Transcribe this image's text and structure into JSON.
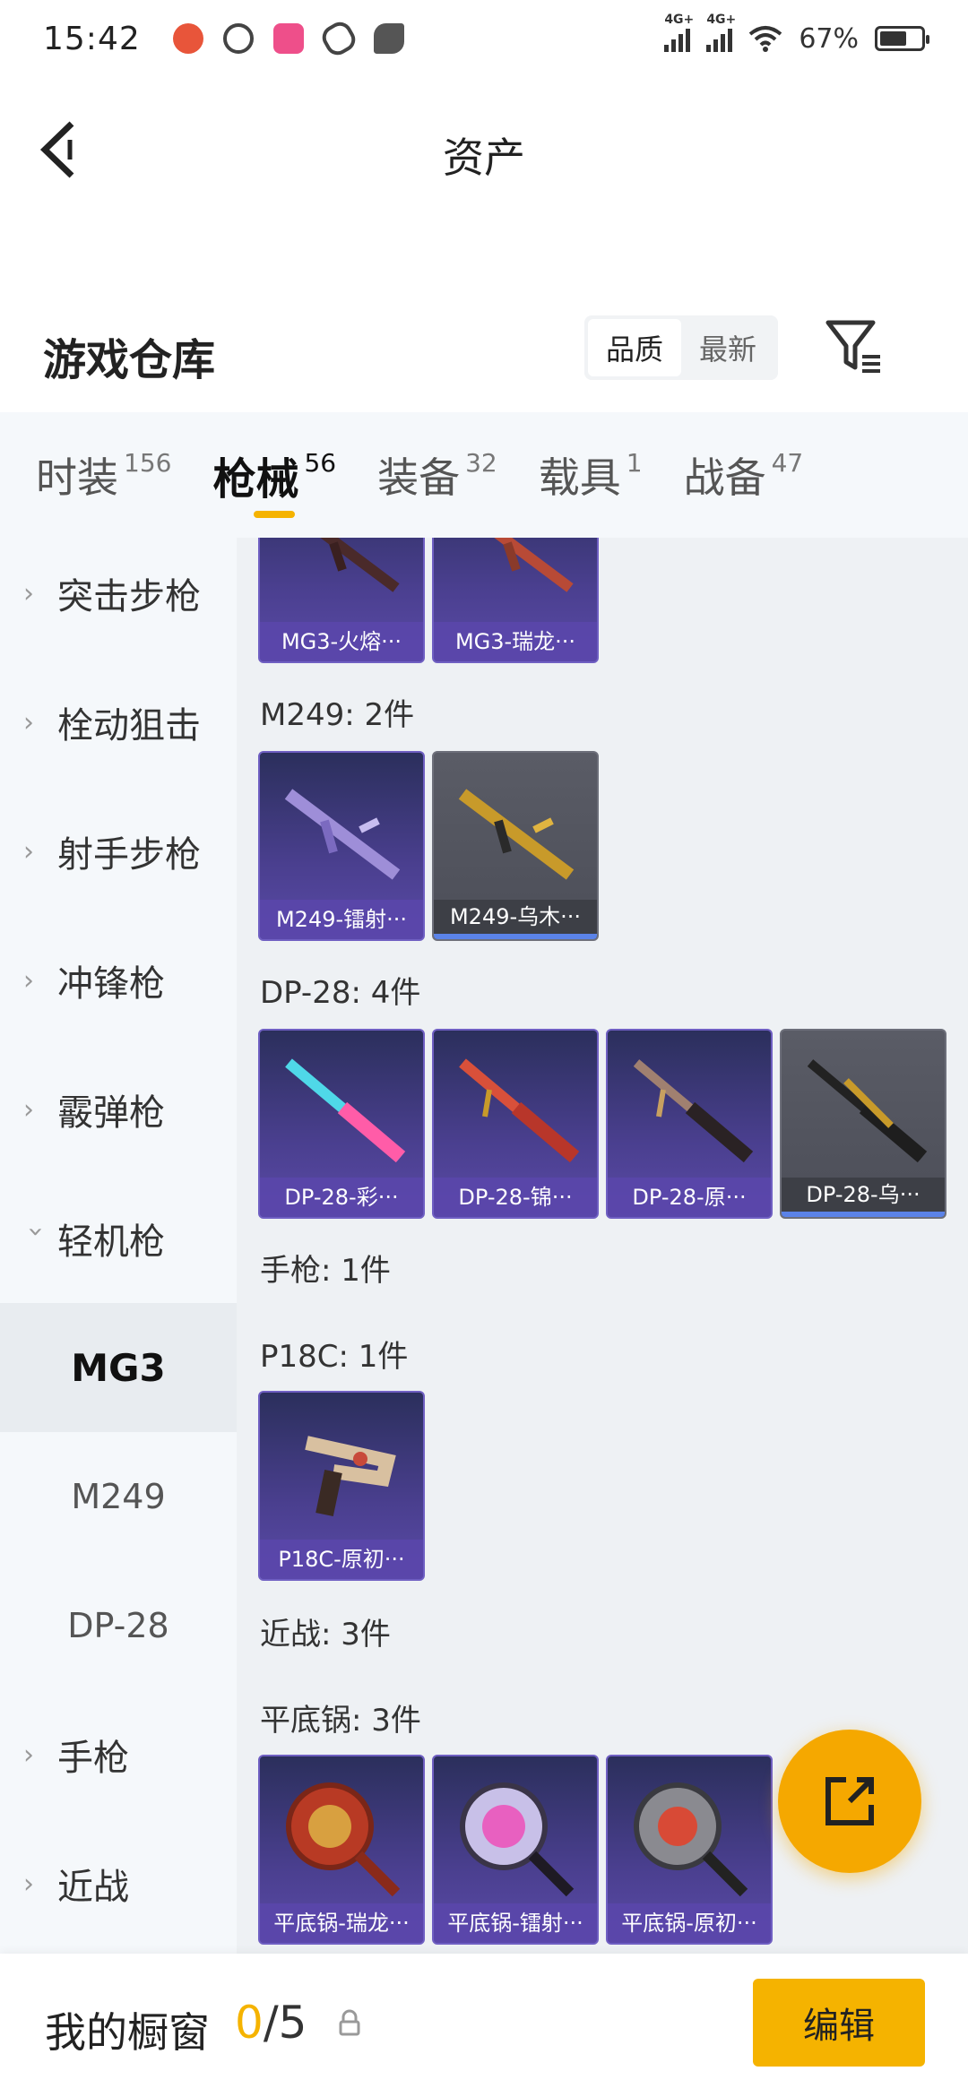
{
  "status_bar": {
    "time": "15:42",
    "network_1": "4G+",
    "network_2": "4G+",
    "battery_text": "67%",
    "battery_level": 0.67
  },
  "header": {
    "title": "资产",
    "back_icon": "chevron-left-icon"
  },
  "warehouse": {
    "title": "游戏仓库",
    "sort_options": [
      "品质",
      "最新"
    ],
    "sort_selected": "品质",
    "filter_icon": "filter-icon"
  },
  "tabs": [
    {
      "label": "时装",
      "count": "156"
    },
    {
      "label": "枪械",
      "count": "56"
    },
    {
      "label": "装备",
      "count": "32"
    },
    {
      "label": "载具",
      "count": "1"
    },
    {
      "label": "战备",
      "count": "47"
    }
  ],
  "active_tab": "枪械",
  "sidebar": {
    "categories": [
      "突击步枪",
      "栓动狙击",
      "射手步枪",
      "冲锋枪",
      "霰弹枪",
      "轻机枪",
      "手枪",
      "近战"
    ],
    "expanded_category": "轻机枪",
    "subitems": [
      "MG3",
      "M249",
      "DP-28"
    ],
    "active_subitem": "MG3"
  },
  "content": {
    "sections": [
      {
        "label": "",
        "items": [
          "MG3-火熔···",
          "MG3-瑞龙···"
        ]
      },
      {
        "label": "M249: 2件",
        "items": [
          "M249-镭射···",
          "M249-乌木···"
        ]
      },
      {
        "label": "DP-28: 4件",
        "items": [
          "DP-28-彩···",
          "DP-28-锦···",
          "DP-28-原···",
          "DP-28-乌···"
        ]
      },
      {
        "label": "手枪: 1件",
        "items": []
      },
      {
        "label": "P18C: 1件",
        "items": [
          "P18C-原初···"
        ]
      },
      {
        "label": "近战: 3件",
        "items": []
      },
      {
        "label": "平底锅: 3件",
        "items": [
          "平底锅-瑞龙···",
          "平底锅-镭射···",
          "平底锅-原初···"
        ]
      }
    ]
  },
  "fab": {
    "icon": "share-external-icon"
  },
  "bottom_bar": {
    "title": "我的橱窗",
    "count_current": "0",
    "count_sep_total": "/5",
    "lock_icon": "lock-icon",
    "edit_label": "编辑"
  },
  "colors": {
    "accent": "#f5b300",
    "card_purple": "#4a3f8f",
    "card_gray": "#55575f",
    "sidebar_bg": "#f5f8fb",
    "content_bg": "#eef1f4"
  }
}
